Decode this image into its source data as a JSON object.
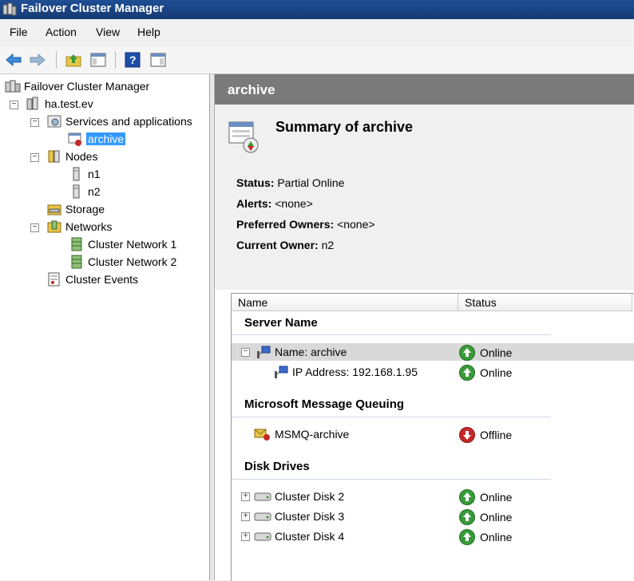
{
  "window": {
    "title": "Failover Cluster Manager"
  },
  "menu": [
    "File",
    "Action",
    "View",
    "Help"
  ],
  "tree": {
    "root": "Failover Cluster Manager",
    "cluster": "ha.test.ev",
    "services": "Services and applications",
    "archive": "archive",
    "nodes": "Nodes",
    "n1": "n1",
    "n2": "n2",
    "storage": "Storage",
    "networks": "Networks",
    "network1": "Cluster Network 1",
    "network2": "Cluster Network 2",
    "events": "Cluster Events"
  },
  "content": {
    "header": "archive",
    "summary_title": "Summary of archive",
    "props": [
      {
        "label": "Status:",
        "value": "Partial Online"
      },
      {
        "label": "Alerts:",
        "value": "<none>"
      },
      {
        "label": "Preferred Owners:",
        "value": "<none>"
      },
      {
        "label": "Current Owner:",
        "value": "n2"
      }
    ],
    "columns": [
      "Name",
      "Status"
    ],
    "groups": {
      "server_name": "Server Name",
      "msmq": "Microsoft Message Queuing",
      "disks": "Disk Drives"
    },
    "rows": {
      "name_archive": {
        "name": "Name: archive",
        "status": "Online"
      },
      "ip": {
        "name": "IP Address: 192.168.1.95",
        "status": "Online"
      },
      "msmq": {
        "name": "MSMQ-archive",
        "status": "Offline"
      },
      "disk2": {
        "name": "Cluster Disk 2",
        "status": "Online"
      },
      "disk3": {
        "name": "Cluster Disk 3",
        "status": "Online"
      },
      "disk4": {
        "name": "Cluster Disk 4",
        "status": "Online"
      }
    }
  },
  "colors": {
    "online": "#3a9a3a",
    "offline": "#c62828",
    "header": "#7a7a7a",
    "titlebar": "#1f4e93"
  }
}
